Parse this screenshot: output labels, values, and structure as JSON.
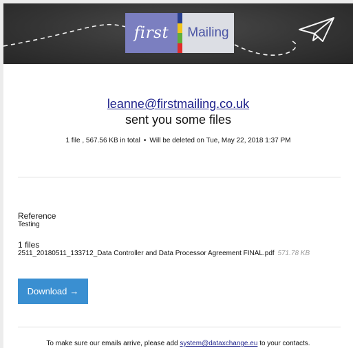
{
  "banner": {
    "logo_word_left": "first",
    "logo_word_right": "Mailing",
    "stripe_colors": [
      "#283f8f",
      "#f0c419",
      "#5fae3a",
      "#e22b2b"
    ],
    "plane_icon": "paper-plane-icon"
  },
  "message": {
    "sender_email": "leanne@firstmailing.co.uk",
    "sent_text": "sent you some files",
    "summary_count_size": "1 file , 567.56 KB in total",
    "separator": "•",
    "summary_deletion": "Will be deleted on Tue, May 22, 2018 1:37 PM"
  },
  "reference": {
    "label": "Reference",
    "value": "Testing"
  },
  "files": {
    "label": "1 files",
    "items": [
      {
        "name": "2511_20180511_133712_Data Controller and Data Processor Agreement FINAL.pdf",
        "size": "571.78 KB"
      }
    ]
  },
  "download": {
    "label": "Download",
    "arrow": "→"
  },
  "footer": {
    "prefix": "To make sure our emails arrive, please add",
    "email": "system@dataxchange.eu",
    "suffix": "to your contacts."
  },
  "colors": {
    "link": "#1b1f8a",
    "button": "#3a8fd1",
    "banner": "#353535"
  }
}
